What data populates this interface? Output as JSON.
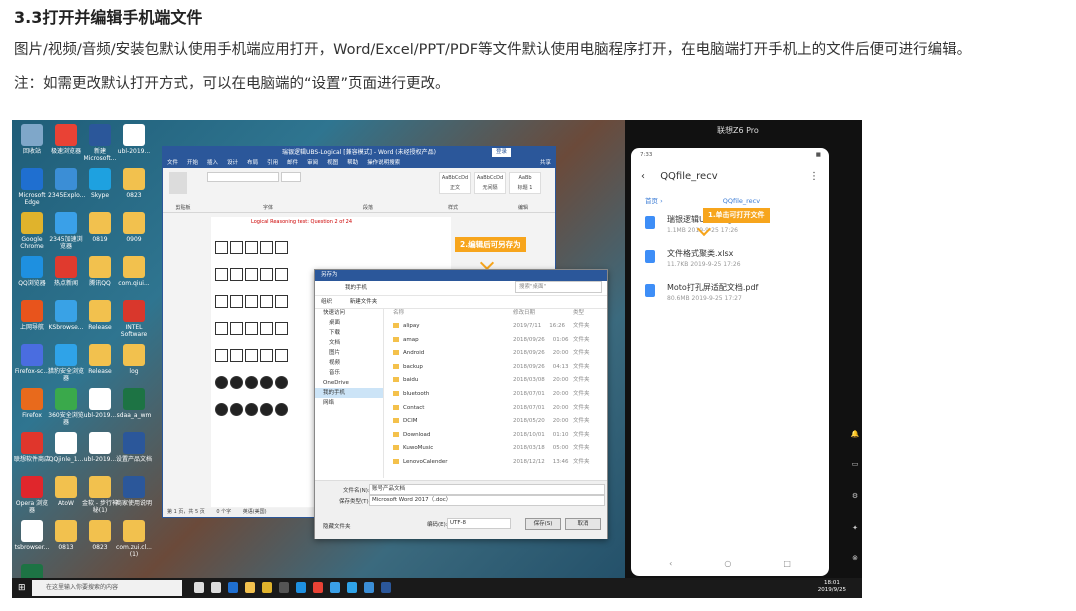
{
  "heading": "3.3打开并编辑手机端文件",
  "paragraph1": "图片/视频/音频/安装包默认使用手机端应用打开，Word/Excel/PPT/PDF等文件默认使用电脑程序打开，在电脑端打开手机上的文件后便可进行编辑。",
  "paragraph2": "注：如需更改默认打开方式，可以在电脑端的“设置”页面进行更改。",
  "screenshot": {
    "desktop_icons": [
      {
        "label": "回收站",
        "color": "#7fa7c9"
      },
      {
        "label": "极速浏览器",
        "color": "#e94235"
      },
      {
        "label": "新建Microsoft...",
        "color": "#2b579a"
      },
      {
        "label": "ubl-2019...",
        "color": "#ffffff"
      },
      {
        "label": "Microsoft Edge",
        "color": "#1f6fd0"
      },
      {
        "label": "2345Explo...",
        "color": "#3b8ed6"
      },
      {
        "label": "Skype",
        "color": "#1ea1e0"
      },
      {
        "label": "0823",
        "color": "#f2c14e"
      },
      {
        "label": "Google Chrome",
        "color": "#e0b32c"
      },
      {
        "label": "2345加速浏览器",
        "color": "#3aa0e8"
      },
      {
        "label": "0819",
        "color": "#f2c14e"
      },
      {
        "label": "0909",
        "color": "#f2c14e"
      },
      {
        "label": "QQ浏览器",
        "color": "#1e90e0"
      },
      {
        "label": "热点新闻",
        "color": "#e03a2e"
      },
      {
        "label": "腾讯QQ",
        "color": "#f2c14e"
      },
      {
        "label": "com.qiui...",
        "color": "#f2c14e"
      },
      {
        "label": "上网导航",
        "color": "#e8541c"
      },
      {
        "label": "KSbrowse...",
        "color": "#39a2e6"
      },
      {
        "label": "Release",
        "color": "#f2c14e"
      },
      {
        "label": "INTEL Software",
        "color": "#d9372c"
      },
      {
        "label": "Firefox-sc...",
        "color": "#4a6de0"
      },
      {
        "label": "猎豹安全浏览器",
        "color": "#2fa3e8"
      },
      {
        "label": "Release",
        "color": "#f2c14e"
      },
      {
        "label": "log",
        "color": "#f2c14e"
      },
      {
        "label": "Firefox",
        "color": "#e86a1c"
      },
      {
        "label": "360安全浏览器",
        "color": "#3aa94b"
      },
      {
        "label": "ubl-2019...",
        "color": "#ffffff"
      },
      {
        "label": "sdaa_a_wm",
        "color": "#1d7344"
      },
      {
        "label": "联想软件商店",
        "color": "#e0362c"
      },
      {
        "label": "QQjinle_1...",
        "color": "#ffffff"
      },
      {
        "label": "ubl-2019...",
        "color": "#ffffff"
      },
      {
        "label": "设置产品文档",
        "color": "#2b579a"
      },
      {
        "label": "Opera 浏览器",
        "color": "#e0262c"
      },
      {
        "label": "AtoW",
        "color": "#f2c14e"
      },
      {
        "label": "金软 - 步行神秘(1)",
        "color": "#f2c14e"
      },
      {
        "label": "商家使用说明",
        "color": "#2b579a"
      },
      {
        "label": "tsbrowser...",
        "color": "#ffffff"
      },
      {
        "label": "0813",
        "color": "#f2c14e"
      },
      {
        "label": "0823",
        "color": "#f2c14e"
      },
      {
        "label": "com.zui.cl... (1)",
        "color": "#f2c14e"
      },
      {
        "label": "文件格式聚类",
        "color": "#1d7344"
      }
    ],
    "word": {
      "title": "瑞银逻辑UBS-Logical [兼容模式] - Word (未经授权产品)",
      "login": "登录",
      "tabs": [
        "文件",
        "开始",
        "插入",
        "设计",
        "布局",
        "引用",
        "邮件",
        "审阅",
        "视图",
        "帮助",
        "操作说明搜索"
      ],
      "share": "共享",
      "ribbon_groups": [
        "剪贴板",
        "字体",
        "段落",
        "样式",
        "编辑"
      ],
      "styles": [
        "AaBbCcDd",
        "AaBbCcDd",
        "AaBb"
      ],
      "style_names": [
        "正文",
        "无间隔",
        "标题 1"
      ],
      "doc_heading": "Logical Reasoning test: Question 2 of 24",
      "status_page": "第 1 页，共 5 页",
      "status_words": "0 个字",
      "status_lang": "英语(美国)"
    },
    "callout_save": "2.编辑后可另存为",
    "callout_open": "1.单击可打开文件",
    "save_dialog": {
      "title": "另存为",
      "path": "我的手机",
      "search_placeholder": "搜索\"桌面\"",
      "organize": "组织",
      "new_folder": "新建文件夹",
      "sidebar": [
        "快速访问",
        "桌面",
        "下载",
        "文档",
        "图片",
        "视频",
        "音乐",
        "OneDrive",
        "我的手机",
        "网络"
      ],
      "col_name": "名称",
      "col_date": "修改日期",
      "col_type": "类型",
      "folders": [
        {
          "name": "alipay",
          "date": "2019/7/11",
          "time": "16:26",
          "type": "文件夹"
        },
        {
          "name": "amap",
          "date": "2018/09/26",
          "time": "01:06",
          "type": "文件夹"
        },
        {
          "name": "Android",
          "date": "2018/09/26",
          "time": "20:00",
          "type": "文件夹"
        },
        {
          "name": "backup",
          "date": "2018/09/26",
          "time": "04:13",
          "type": "文件夹"
        },
        {
          "name": "baidu",
          "date": "2018/03/08",
          "time": "20:00",
          "type": "文件夹"
        },
        {
          "name": "bluetooth",
          "date": "2018/07/01",
          "time": "20:00",
          "type": "文件夹"
        },
        {
          "name": "Contact",
          "date": "2018/07/01",
          "time": "20:00",
          "type": "文件夹"
        },
        {
          "name": "DCIM",
          "date": "2018/05/20",
          "time": "20:00",
          "type": "文件夹"
        },
        {
          "name": "Download",
          "date": "2018/10/01",
          "time": "01:10",
          "type": "文件夹"
        },
        {
          "name": "KuwoMusic",
          "date": "2018/03/18",
          "time": "05:00",
          "type": "文件夹"
        },
        {
          "name": "LenovoCalender",
          "date": "2018/12/12",
          "time": "13:46",
          "type": "文件夹"
        }
      ],
      "filename_label": "文件名(N):",
      "filename_value": "账号产品文档",
      "filetype_label": "保存类型(T):",
      "filetype_value": "Microsoft Word 2017（.doc）",
      "hide_folders": "隐藏文件夹",
      "encoding_label": "编码(E):",
      "encoding_value": "UTF-8",
      "save_btn": "保存(S)",
      "cancel_btn": "取消"
    },
    "phone": {
      "device": "联想Z6 Pro",
      "time": "7:33",
      "battery": "■",
      "title": "QQfile_recv",
      "crumb_home": "首页",
      "crumb_current": "QQfile_recv",
      "files": [
        {
          "name": "瑞银逻辑UBS-Logical.doc",
          "meta": "1.1MB  2019-9-25 17:26"
        },
        {
          "name": "文件格式聚类.xlsx",
          "meta": "11.7KB  2019-9-25 17:26"
        },
        {
          "name": "Moto打孔屏适配文档.pdf",
          "meta": "80.6MB  2019-9-25 17:27"
        }
      ],
      "nav": [
        "‹",
        "○",
        "□"
      ]
    },
    "taskbar": {
      "search": "在这里输入你要搜索的内容",
      "time": "18:01",
      "date": "2019/9/25"
    }
  }
}
